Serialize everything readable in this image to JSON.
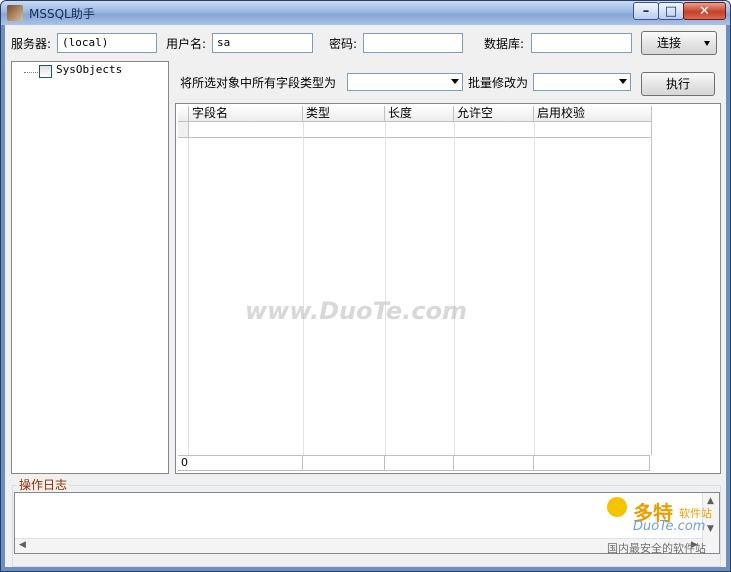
{
  "window": {
    "title": "MSSQL助手"
  },
  "connection": {
    "server_label": "服务器:",
    "server_value": "(local)",
    "user_label": "用户名:",
    "user_value": "sa",
    "password_label": "密码:",
    "password_value": "",
    "database_label": "数据库:",
    "database_value": "",
    "connect_label": "连接"
  },
  "tree": {
    "items": [
      {
        "label": "SysObjects",
        "checked": false
      }
    ]
  },
  "toolbar": {
    "set_type_label": "将所选对象中所有字段类型为",
    "batch_modify_label": "批量修改为",
    "execute_label": "执行"
  },
  "grid": {
    "columns": [
      "字段名",
      "类型",
      "长度",
      "允许空",
      "启用校验"
    ],
    "footer": {
      "count": "0"
    }
  },
  "log": {
    "title": "操作日志"
  },
  "watermark": {
    "text": "www.DuoTe.com"
  },
  "corner": {
    "brand": "多特",
    "site": "软件站",
    "url": "DuoTe.com",
    "slogan": "国内最安全的软件站"
  },
  "colors": {
    "titlebar": "#9bb8e2",
    "log_title": "#8b2c00",
    "close_button": "#c4412a"
  }
}
